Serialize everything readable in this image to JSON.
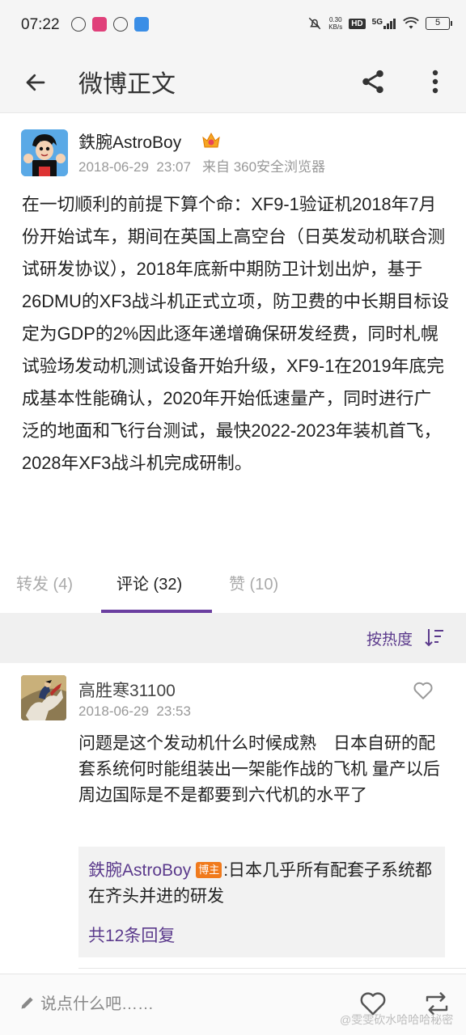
{
  "status_bar": {
    "time": "07:22",
    "speed_value": "0.30",
    "speed_unit": "KB/s",
    "hd": "HD",
    "network": "5G",
    "battery": "5"
  },
  "app_bar": {
    "title": "微博正文",
    "icons": [
      "back-arrow-icon",
      "share-icon",
      "more-vertical-icon"
    ]
  },
  "post": {
    "author": "鉄腕AstroBoy",
    "date": "2018-06-29",
    "time": "23:07",
    "source": "来自 360安全浏览器",
    "text": "在一切顺利的前提下算个命：XF9-1验证机2018年7月份开始试车，期间在英国上高空台（日英发动机联合测试研发协议），2018年底新中期防卫计划出炉，基于26DMU的XF3战斗机正式立项，防卫费的中长期目标设定为GDP的2%因此逐年递增确保研发经费，同时札幌试验场发动机测试设备开始升级，XF9-1在2019年底完成基本性能确认，2020年开始低速量产，同时进行广泛的地面和飞行台测试，最快2022-2023年装机首飞，2028年XF3战斗机完成研制。"
  },
  "tabs": {
    "repost": "转发 (4)",
    "comments": "评论 (32)",
    "likes": "赞 (10)"
  },
  "sort": {
    "label": "按热度"
  },
  "comment": {
    "author": "高胜寒31100",
    "time": "2018-06-29  23:53",
    "text": "问题是这个发动机什么时候成熟　日本自研的配套系统何时能组装出一架能作战的飞机  量产以后周边国际是不是都要到六代机的水平了",
    "reply": {
      "author": "鉄腕AstroBoy",
      "badge": "博主",
      "text": ":日本几乎所有配套子系统都在齐头并进的研发",
      "more": "共12条回复"
    }
  },
  "bottom_bar": {
    "placeholder": "说点什么吧……",
    "watermark": "@雯雯砍水哈哈哈秘密"
  },
  "colors": {
    "accent": "#5b3a8c",
    "tab_underline": "#6b3fa0",
    "badge": "#f07a1c"
  }
}
